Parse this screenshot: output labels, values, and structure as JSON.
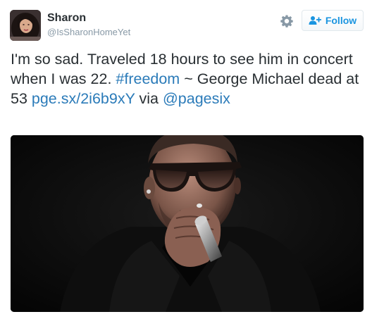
{
  "user": {
    "display_name": "Sharon",
    "handle": "@IsSharonHomeYet"
  },
  "actions": {
    "follow_label": "Follow"
  },
  "tweet": {
    "text_1": "I'm so sad. Traveled 18 hours to see him in concert when I was 22. ",
    "hashtag": "#freedom",
    "text_2": " ~ George Michael dead at 53 ",
    "link": "pge.sx/2i6b9xY",
    "text_3": " via ",
    "mention": "@pagesix"
  },
  "colors": {
    "link": "#2b7bb9",
    "follow_text": "#1b95e0",
    "handle": "#8899a6",
    "text": "#292f33"
  },
  "icons": {
    "settings": "gear-icon",
    "follow": "add-user-icon"
  }
}
